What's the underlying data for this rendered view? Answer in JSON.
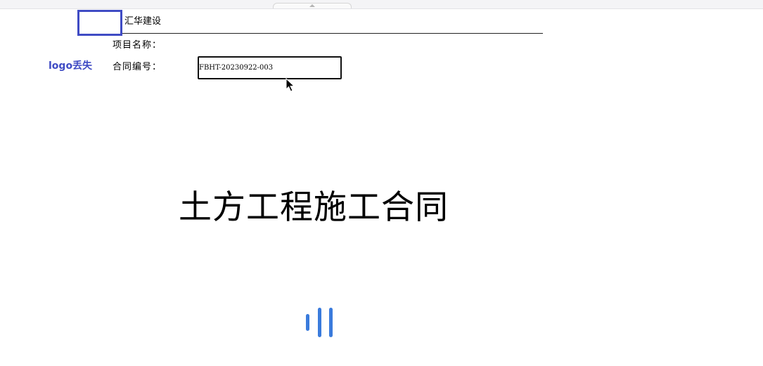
{
  "header": {
    "company_name": "汇华建设",
    "logo_missing_text": "logo丢失"
  },
  "fields": {
    "project_name_label": "项目名称：",
    "contract_no_label": "合同编号：",
    "contract_no_value": "FBHT-20230922-003"
  },
  "document": {
    "title": "土方工程施工合同"
  },
  "icons": {
    "collapse": "chevron-up-icon",
    "cursor": "mouse-pointer-icon",
    "loading": "loading-bars-icon"
  },
  "colors": {
    "logo_accent": "#3f4bc4",
    "loader": "#3a7bdc"
  }
}
